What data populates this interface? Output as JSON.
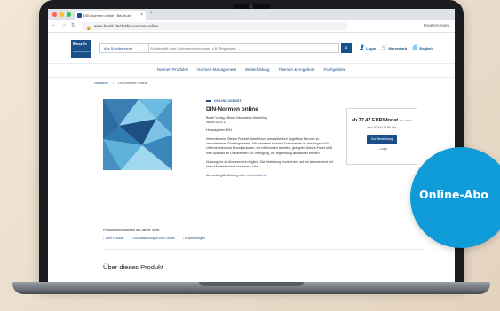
{
  "browser": {
    "tab_title": "DIN-Normen online | Beuth.de",
    "url": "www.beuth.de/de/din-normen-online",
    "extensions_label": "Erweiterungen"
  },
  "header": {
    "logo_line1": "Beuth",
    "logo_line2": "publishing DIN",
    "search_category": "Alle Suchbereiche",
    "search_placeholder": "Suchbegriff oder Dokumentennummer, z.B. Regelwerk ...",
    "login_label": "Login",
    "cart_label": "Warenkorb",
    "lang_label": "English"
  },
  "main_nav": [
    "Normen-Produkte",
    "Normen-Management",
    "Weiterbildung",
    "Themen & Angebote",
    "Fachgebiete"
  ],
  "breadcrumb": {
    "home": "Startseite",
    "current": "DIN-Normen online"
  },
  "product": {
    "kicker": "ONLINE-DIENST",
    "title": "DIN-Normen online",
    "meta_line1": "Beuth Verlag / Beuth Information Marketing",
    "meta_line2": "Stand 2023-11",
    "publisher_label": "Herausgeber: DIN",
    "description": "Informationen: Dieses Produkt bietet Ihnen ausschließlich Zugriff auf Normen zu verschiedenen Einsatzgebieten. Mit mehreren tausend Dokumenten ist das Angebot für Unternehmen und Einzelpersonen, die mit Normen arbeiten, geeignet. Dieses Paket stellt eine Auswahl an Dokumenten zur Verfügung, die regelmäßig aktualisiert werden.",
    "note": "Nutzung nur im Abonnement möglich. Die Bestellung bezieht sich auf ein Abonnement mit einer Mindestlaufzeit von einem Jahr.",
    "contact_prefix": "Anmeldung/Bestellung unter",
    "contact_link": "www.beuth.de"
  },
  "pricebox": {
    "price": "ab 77,47 EUR/Monat",
    "price_suffix": "inkl. MwSt.",
    "price_sub": "bzw. 929,64 EUR/Jahr",
    "buy_label": "Zur Bestellung",
    "login_label": "→ Login"
  },
  "related": {
    "title": "Produktinformationen auf dieser Seite",
    "links": [
      "Zum Produkt",
      "Voraussetzungen zum Testen",
      "Empfehlungen"
    ]
  },
  "about_heading": "Über dieses Produkt",
  "badge": {
    "text": "Online-Abo"
  },
  "colors": {
    "brand": "#1b4f8a",
    "badge": "#0f9bd8"
  }
}
